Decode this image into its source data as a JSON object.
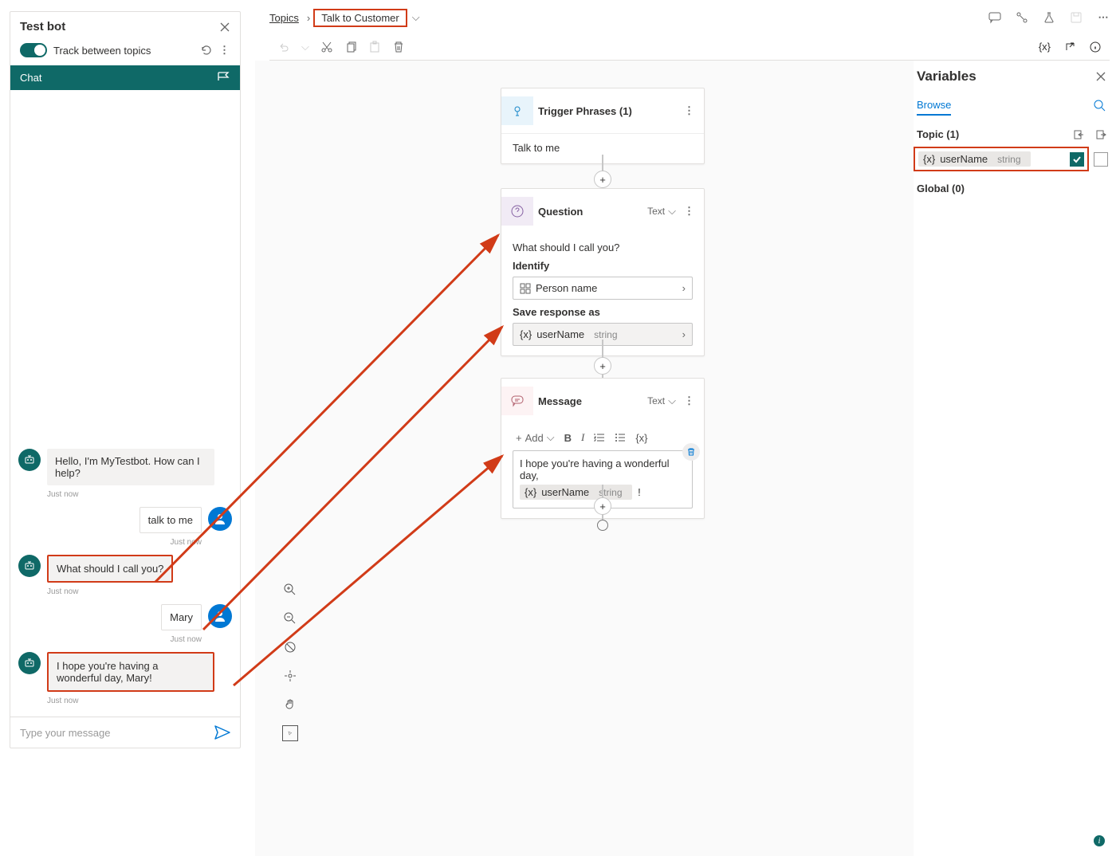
{
  "testbot": {
    "title": "Test bot",
    "track_label": "Track between topics",
    "chat_label": "Chat",
    "messages": {
      "bot1": "Hello, I'm MyTestbot. How can I help?",
      "ts": "Just now",
      "user1": "talk to me",
      "bot2": "What should I call you?",
      "user2": "Mary",
      "bot3": "I hope you're having a wonderful day, Mary!"
    },
    "input_placeholder": "Type your message"
  },
  "breadcrumb": {
    "root": "Topics",
    "current": "Talk to Customer"
  },
  "toolbar_right_var": "{x}",
  "nodes": {
    "trigger": {
      "title": "Trigger Phrases (1)",
      "phrase": "Talk to me"
    },
    "question": {
      "title": "Question",
      "type": "Text",
      "prompt": "What should I call you?",
      "identify_label": "Identify",
      "identify_value": "Person name",
      "save_label": "Save response as",
      "var_name": "userName",
      "var_type": "string",
      "var_x": "{x}"
    },
    "message": {
      "title": "Message",
      "type": "Text",
      "add_label": "Add",
      "toolbar_b": "B",
      "toolbar_i": "I",
      "toolbar_x": "{x}",
      "text": "I hope you're having a wonderful day,",
      "var_name": "userName",
      "var_type": "string",
      "var_x": "{x}",
      "punct": "!"
    }
  },
  "variables": {
    "title": "Variables",
    "tab": "Browse",
    "scope": "Topic (1)",
    "var_x": "{x}",
    "var_name": "userName",
    "var_type": "string",
    "global": "Global (0)"
  },
  "info": "i"
}
